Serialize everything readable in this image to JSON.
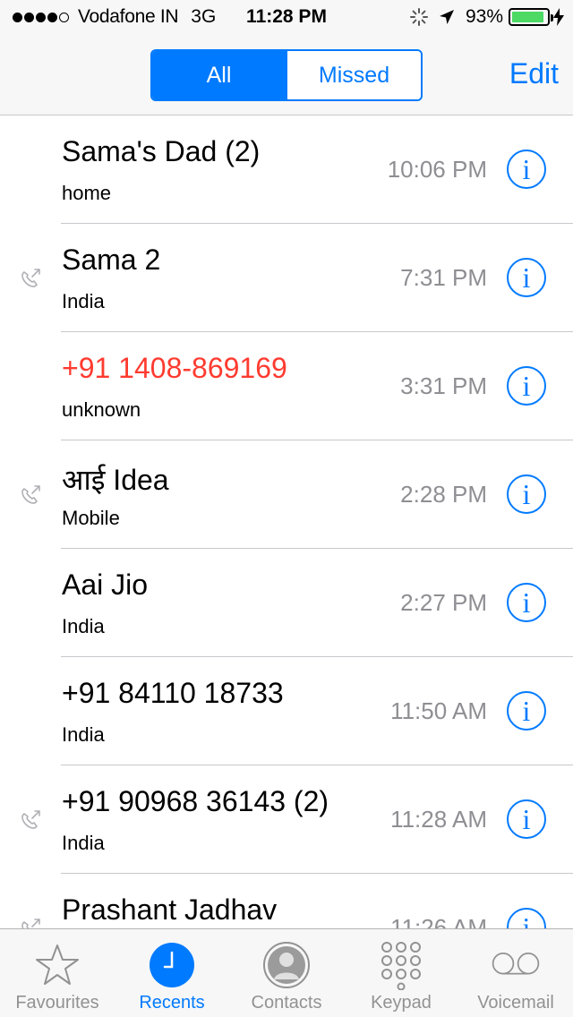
{
  "status_bar": {
    "carrier": "Vodafone IN",
    "network": "3G",
    "time": "11:28 PM",
    "battery_percent": "93%",
    "battery_level": 0.93,
    "signal_bars": 4,
    "signal_max": 5
  },
  "nav": {
    "segments": [
      "All",
      "Missed"
    ],
    "selected_segment": "All",
    "edit_label": "Edit"
  },
  "calls": [
    {
      "name": "Sama's Dad (2)",
      "sub": "home",
      "time": "10:06 PM",
      "outgoing": false,
      "missed": false
    },
    {
      "name": "Sama 2",
      "sub": "India",
      "time": "7:31 PM",
      "outgoing": true,
      "missed": false
    },
    {
      "name": "+91 1408-869169",
      "sub": "unknown",
      "time": "3:31 PM",
      "outgoing": false,
      "missed": true
    },
    {
      "name": "आई Idea",
      "sub": "Mobile",
      "time": "2:28 PM",
      "outgoing": true,
      "missed": false
    },
    {
      "name": "Aai Jio",
      "sub": "India",
      "time": "2:27 PM",
      "outgoing": false,
      "missed": false
    },
    {
      "name": "+91 84110 18733",
      "sub": "India",
      "time": "11:50 AM",
      "outgoing": false,
      "missed": false
    },
    {
      "name": "+91 90968 36143 (2)",
      "sub": "India",
      "time": "11:28 AM",
      "outgoing": true,
      "missed": false
    },
    {
      "name": "Prashant Jadhav",
      "sub": "",
      "time": "11:26 AM",
      "outgoing": true,
      "missed": false
    }
  ],
  "info_glyph": "i",
  "tabs": [
    {
      "label": "Favourites",
      "icon": "star-icon",
      "active": false
    },
    {
      "label": "Recents",
      "icon": "clock-icon",
      "active": true
    },
    {
      "label": "Contacts",
      "icon": "person-icon",
      "active": false
    },
    {
      "label": "Keypad",
      "icon": "keypad-icon",
      "active": false
    },
    {
      "label": "Voicemail",
      "icon": "voicemail-icon",
      "active": false
    }
  ],
  "colors": {
    "accent": "#007aff",
    "missed": "#ff3b30",
    "secondary_text": "#8e8e93",
    "battery": "#4cd964"
  }
}
